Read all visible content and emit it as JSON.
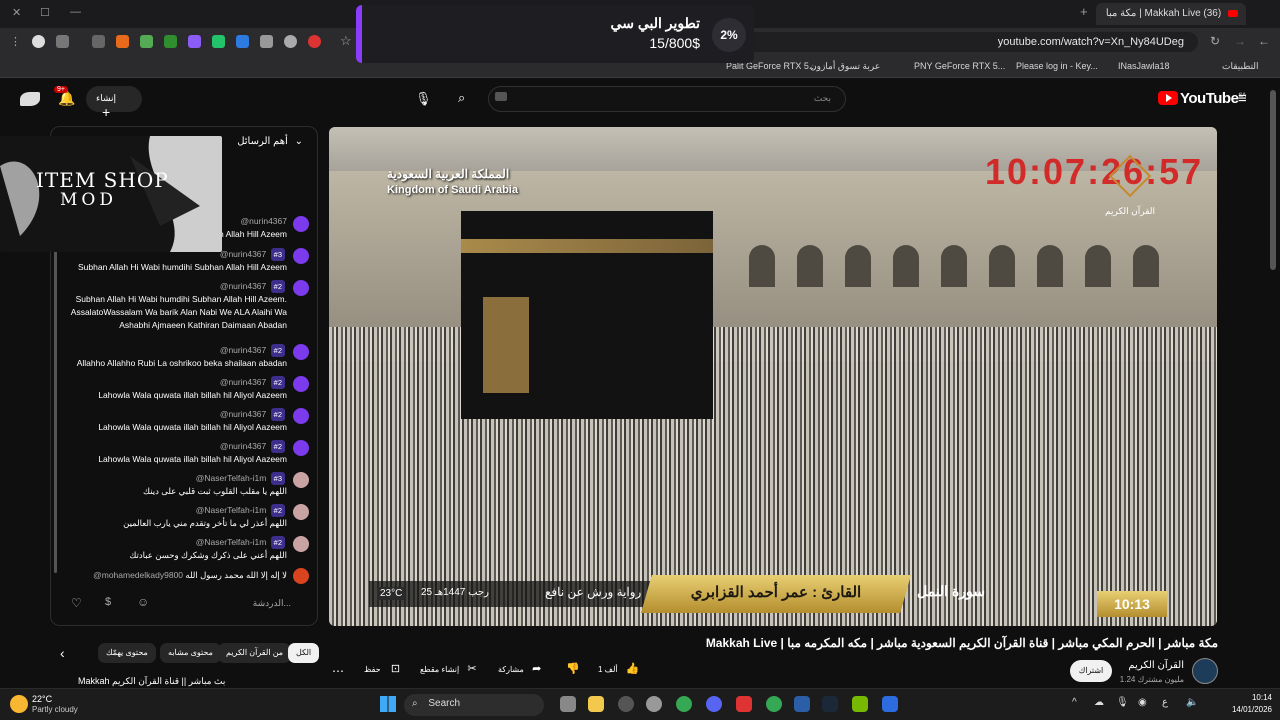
{
  "browser": {
    "tab_title": "(36) Makkah Live | مكة مبا",
    "url": "youtube.com/watch?v=Xn_Ny84UDeg",
    "bookmarks": [
      "Palit GeForce RTX 5...",
      "عربة تسوق أمازون",
      "PNY GeForce RTX 5...",
      "Please log in - Key...",
      "INasJawla18",
      "التطبيقات"
    ]
  },
  "promo": {
    "title": "تطوير البي سي",
    "progress_text": "15/800$",
    "percent": "2%"
  },
  "header": {
    "search_placeholder": "بحث",
    "logo": "YouTube",
    "region": "SA",
    "create_label": "إنشاء",
    "notif_count": "9+"
  },
  "chat": {
    "header": "أهم الرسائل",
    "input_placeholder": "الدردشة...",
    "messages": [
      {
        "author": "@nurin4367",
        "badge": "",
        "text": "Subhan Allah Hi Wabi hamdihi Subhan Allah Hill Azeem"
      },
      {
        "author": "@nurin4367",
        "badge": "#3",
        "text": "Subhan Allah Hi Wabi humdihi Subhan Allah Hill Azeem"
      },
      {
        "author": "@nurin4367",
        "badge": "#2",
        "text": "Subhan Allah Hi Wabi humdihi Subhan Allah Hill Azeem. AssalatoWassalam Wa barik Alan Nabi We ALA Alaihi Wa Ashabhi Ajmaeen Kathiran Daimaan Abadan"
      },
      {
        "author": "@nurin4367",
        "badge": "#2",
        "text": "Allahho Allahho Rubi La oshrikoo beka shailaan abadan"
      },
      {
        "author": "@nurin4367",
        "badge": "#2",
        "text": "Lahowla Wala quwata illah billah hil Aliyol Aazeem"
      },
      {
        "author": "@nurin4367",
        "badge": "#2",
        "text": "Lahowla Wala quwata illah billah hil Aliyol Aazeem"
      },
      {
        "author": "@nurin4367",
        "badge": "#2",
        "text": "Lahowla Wala quwata illah billah hil Aliyol Aazeem"
      },
      {
        "author": "@NaserTelfah-i1m",
        "badge": "#3",
        "text": "اللهم يا مقلب القلوب ثبت قلبي على دينك"
      },
      {
        "author": "@NaserTelfah-i1m",
        "badge": "#2",
        "text": "اللهم أعذر لي ما تأخر وتقدم مني يارب العالمين"
      },
      {
        "author": "@NaserTelfah-i1m",
        "badge": "#2",
        "text": "اللهم أعني على ذكرك وشكرك وحسن عبادتك"
      },
      {
        "author": "@mohamedelkady9800",
        "badge": "",
        "text": "لا إله إلا الله محمد رسول الله"
      }
    ]
  },
  "overlay": {
    "title": "ITEM SHOP",
    "subtitle": "MOD"
  },
  "video": {
    "country_ar": "المملكة العربية السعودية",
    "country_en": "Kingdom of Saudi Arabia",
    "clock": "10:07:26:57",
    "channel_mark": "القرآن الكريم",
    "qari": "القارئ : عمر أحمد القزابري",
    "surah": "سورة النمل",
    "riwaya": "رواية ورش عن نافع",
    "hijri": "25 رجب 1447هـ",
    "temp": "23°C",
    "time": "10:13"
  },
  "below": {
    "title": "مكة مباشر | الحرم المكي مباشر | قناة القرآن الكريم السعودية مباشر | مكه المكرمه مبا | Makkah Live",
    "chips": [
      "الكل",
      "من القرآن الكريم",
      "محتوى مشابه",
      "محتوى يهمّك"
    ],
    "actions": {
      "like_count": "1 ألف",
      "share": "مشاركة",
      "clip": "إنشاء مقطع",
      "save": "حفظ"
    },
    "channel_name": "القرآن الكريم",
    "channel_subs": "1.24 مليون مشترك",
    "subscribe": "اشتراك",
    "next_title": "Makkah بث مباشر || قناة القرآن الكريم"
  },
  "taskbar": {
    "weather_temp": "22°C",
    "weather_cond": "Partly cloudy",
    "search": "Search",
    "time": "10:14",
    "date": "14/01/2026"
  }
}
